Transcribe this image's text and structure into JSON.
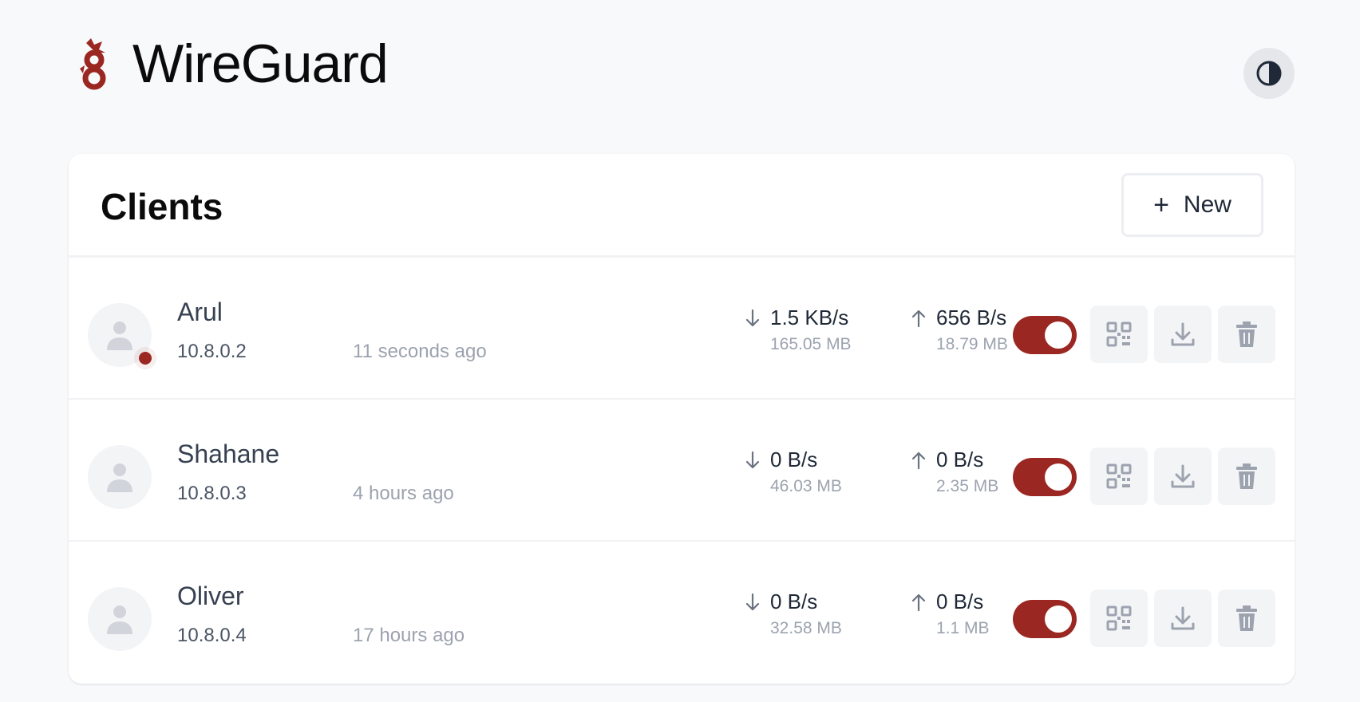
{
  "app": {
    "title": "WireGuard",
    "accent_color": "#9b2722",
    "logo_icon": "wireguard-dragon-logo",
    "theme_toggle_icon": "contrast-half-circle-icon"
  },
  "clients_card": {
    "title": "Clients",
    "new_button_label": "New",
    "new_button_icon": "plus-icon"
  },
  "clients": [
    {
      "name": "Arul",
      "address": "10.8.0.2",
      "last_seen": "11 seconds ago",
      "online": true,
      "download_rate": "1.5 KB/s",
      "download_total": "165.05 MB",
      "upload_rate": "656 B/s",
      "upload_total": "18.79 MB",
      "enabled": true
    },
    {
      "name": "Shahane",
      "address": "10.8.0.3",
      "last_seen": "4 hours ago",
      "online": false,
      "download_rate": "0 B/s",
      "download_total": "46.03 MB",
      "upload_rate": "0 B/s",
      "upload_total": "2.35 MB",
      "enabled": true
    },
    {
      "name": "Oliver",
      "address": "10.8.0.4",
      "last_seen": "17 hours ago",
      "online": false,
      "download_rate": "0 B/s",
      "download_total": "32.58 MB",
      "upload_rate": "0 B/s",
      "upload_total": "1.1 MB",
      "enabled": true
    }
  ],
  "row_actions": [
    "qr-code-icon",
    "download-icon",
    "trash-icon"
  ]
}
